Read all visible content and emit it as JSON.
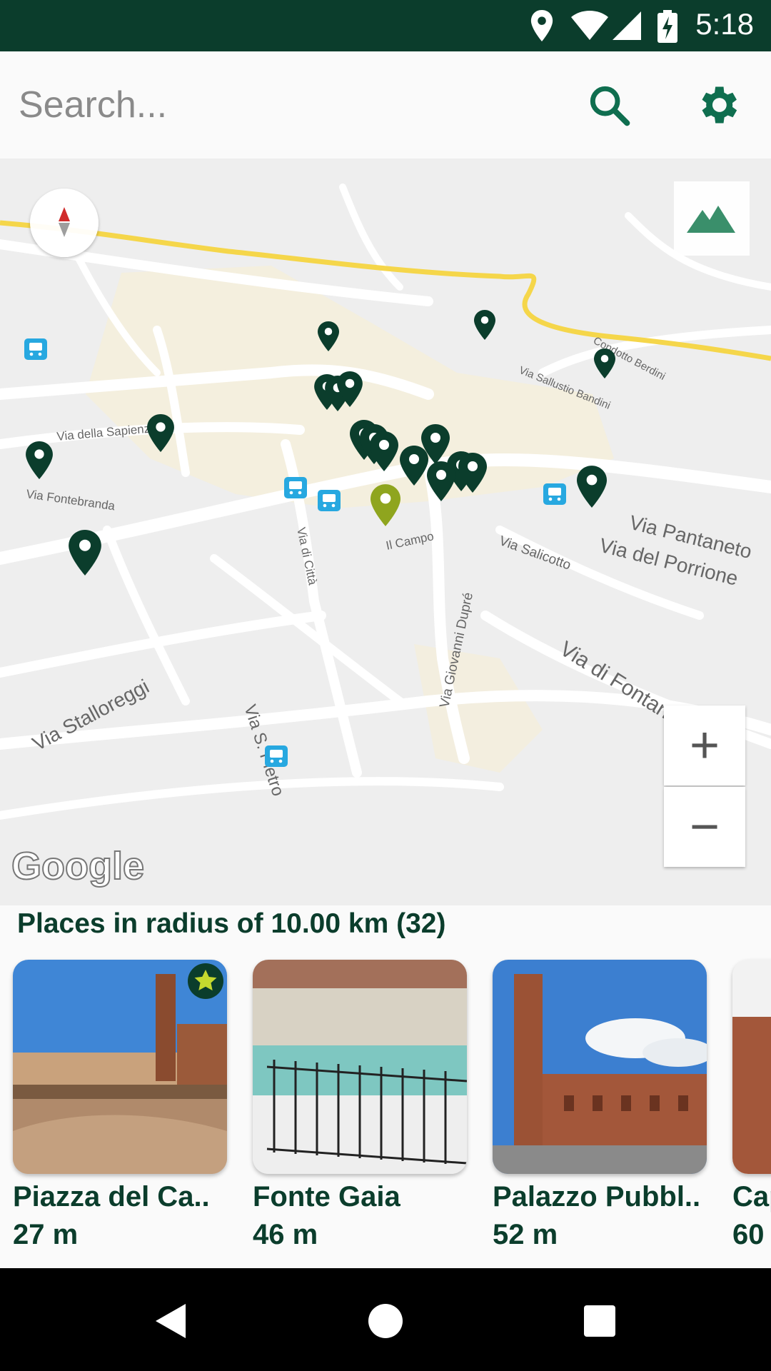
{
  "status_bar": {
    "time": "5:18",
    "icons": [
      "location-icon",
      "wifi-icon",
      "signal-icon",
      "battery-charging-icon"
    ]
  },
  "search": {
    "placeholder": "Search..."
  },
  "map": {
    "street_labels": [
      "Via della Sapienza",
      "Via Fontebranda",
      "Via di Città",
      "Il Campo",
      "Via Salicotto",
      "Via Pantaneto",
      "Via del Porrione",
      "Via Giovanni Dupré",
      "Via Stalloreggi",
      "Via S. Pietro",
      "Via di Fontanella",
      "Via Sallustio Bandini",
      "Condotto Berdini"
    ],
    "attribution": "Google",
    "zoom_in_label": "+",
    "zoom_out_label": "−",
    "colors": {
      "pin": "#0b3d2c",
      "selected_pin": "#8fa51e",
      "road_major": "#f5d64a",
      "bus_stop": "#27a8e0"
    }
  },
  "places": {
    "title": "Places in radius of 10.00 km (32)",
    "items": [
      {
        "name": "Piazza del Ca..",
        "distance": "27 m",
        "starred": true
      },
      {
        "name": "Fonte Gaia",
        "distance": "46 m",
        "starred": false
      },
      {
        "name": "Palazzo Pubbl..",
        "distance": "52 m",
        "starred": false
      },
      {
        "name": "Cap",
        "distance": "60",
        "starred": false
      }
    ]
  },
  "nav_bar": {
    "icons": [
      "back-icon",
      "home-icon",
      "recents-icon"
    ]
  }
}
